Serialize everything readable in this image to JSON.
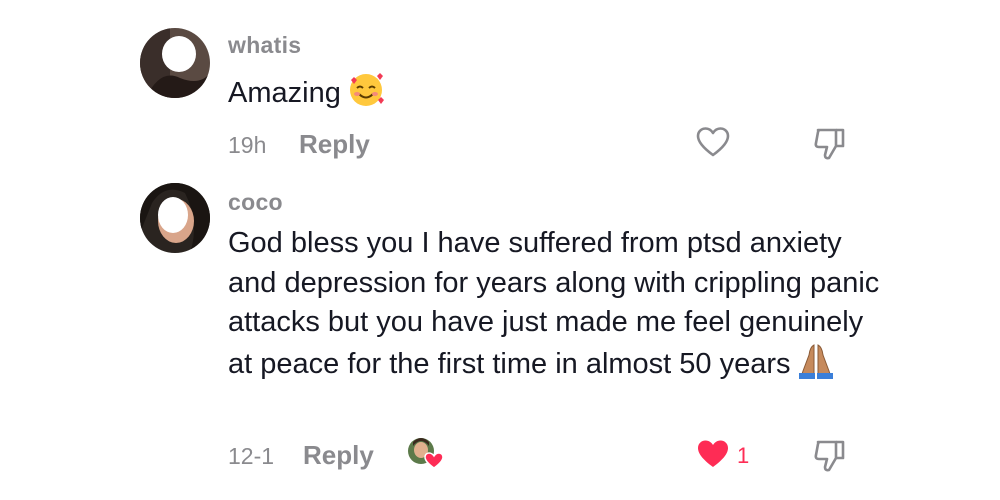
{
  "comments": [
    {
      "username": "whatis",
      "text": "Amazing",
      "emoji": "smiling-face-with-hearts",
      "time": "19h",
      "reply_label": "Reply",
      "liked": false,
      "like_count": ""
    },
    {
      "username": "coco",
      "text": "God bless you I have suffered from ptsd anxiety and depression for years along with crippling panic attacks but you have just made me feel genuinely at peace for the first time in almost 50 years",
      "emoji": "folded-hands",
      "time": "12-1",
      "reply_label": "Reply",
      "liked": true,
      "like_count": "1",
      "creator_liked": true
    }
  ],
  "colors": {
    "text": "#161823",
    "muted": "#8a8a8e",
    "like": "#fe2c55"
  }
}
